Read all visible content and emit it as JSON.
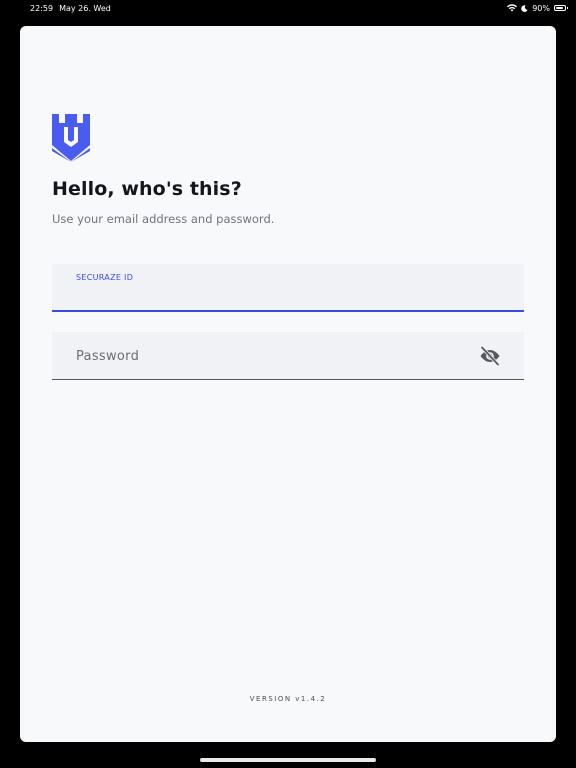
{
  "status_bar": {
    "time": "22:59",
    "date": "May 26. Wed",
    "battery": "90%",
    "battery_level": 0.9
  },
  "login": {
    "title": "Hello, who's this?",
    "subtitle": "Use your email address and password.",
    "id_field": {
      "label": "SECURAZE ID",
      "value": ""
    },
    "password_field": {
      "placeholder": "Password",
      "value": ""
    },
    "version": "VERSION v1.4.2"
  },
  "colors": {
    "accent": "#3b4ce0",
    "logo": "#4a5bf0",
    "background": "#f8f9fb",
    "field_background": "#f1f2f5",
    "title_text": "#14161c"
  },
  "icons": {
    "logo": "shield-castle-icon",
    "password_toggle": "eye-off-icon"
  }
}
